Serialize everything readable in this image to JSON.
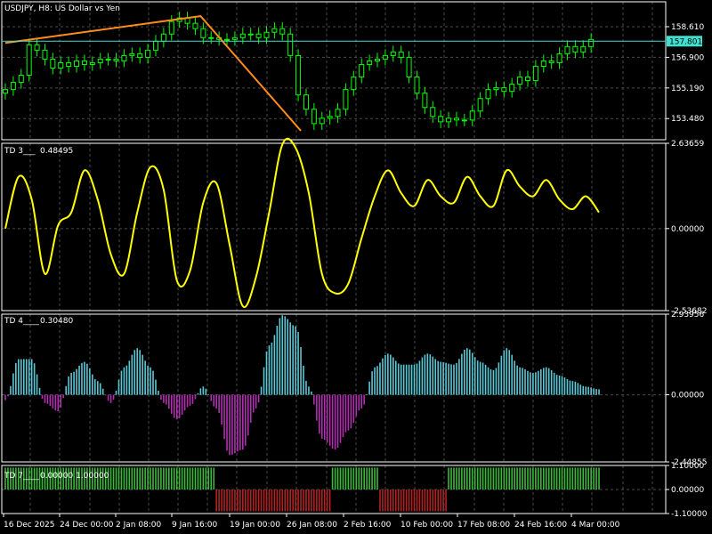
{
  "header": {
    "symbol_title": "USDJPY, H8:  US Dollar vs Yen",
    "td3_name": "TD 3___",
    "td3_value": "0.48495",
    "td4_name": "TD 4____",
    "td4_value": "0.30480",
    "td7_name": "TD 7____",
    "td7_values": "0.00000  1.00000"
  },
  "colors": {
    "background": "#000000",
    "grid": "#4a4a4a",
    "candle": "#00ff00",
    "price_line": "#40e0d0",
    "trend_line": "#ff8c1a",
    "td3_line": "#ffff00",
    "td4_positive": "#5bc8d6",
    "td4_negative": "#b22fb2",
    "td7_positive": "#3cb83c",
    "td7_negative": "#b02222"
  },
  "chart_data": [
    {
      "type": "line",
      "name": "price",
      "title": "USDJPY, H8:  US Dollar vs Yen",
      "ylim": [
        152.3,
        160.0
      ],
      "y_ticks": [
        "158.610",
        "156.900",
        "155.190",
        "153.480"
      ],
      "current_price": "157.801",
      "current_price_value": 157.801,
      "x": [
        0,
        3,
        6,
        9,
        12,
        15,
        18,
        21,
        24,
        27,
        30,
        33,
        36,
        39,
        42,
        45,
        48,
        51,
        54,
        57,
        60,
        63,
        66,
        69,
        72,
        75,
        78,
        81,
        84,
        87,
        90,
        93,
        96,
        99,
        102,
        105,
        108,
        111,
        114,
        117,
        120,
        123,
        126,
        129,
        132,
        135,
        138,
        141,
        144,
        147,
        150,
        153,
        156,
        159,
        162,
        165,
        168,
        171,
        174,
        177,
        180,
        183,
        186,
        189,
        192,
        195,
        198,
        201,
        204,
        207,
        210,
        213,
        216,
        219,
        222
      ],
      "close": [
        155.1,
        155.5,
        155.9,
        157.6,
        157.3,
        156.8,
        156.3,
        156.6,
        156.4,
        156.7,
        156.5,
        156.6,
        156.8,
        156.8,
        156.7,
        157.0,
        157.1,
        156.9,
        157.3,
        157.8,
        158.2,
        158.9,
        159.1,
        158.8,
        158.5,
        158.0,
        158.0,
        157.9,
        157.9,
        158.0,
        158.2,
        158.2,
        158.0,
        158.3,
        158.5,
        158.2,
        157.0,
        154.8,
        154.0,
        153.2,
        153.5,
        153.6,
        154.0,
        155.1,
        155.8,
        156.5,
        156.7,
        156.8,
        157.0,
        157.2,
        156.9,
        155.8,
        154.9,
        154.1,
        153.6,
        153.3,
        153.5,
        153.4,
        153.4,
        153.9,
        154.6,
        155.1,
        155.2,
        155.0,
        155.4,
        155.8,
        155.6,
        156.4,
        156.7,
        156.6,
        157.1,
        157.5,
        157.2,
        157.5,
        157.9
      ],
      "trend_line": [
        {
          "x": 0,
          "y": 157.7
        },
        {
          "x": 74,
          "y": 159.2
        },
        {
          "x": 112,
          "y": 152.8
        }
      ]
    },
    {
      "type": "line",
      "name": "TD 3",
      "ylim": [
        -2.53682,
        2.63659
      ],
      "y_ticks": [
        "2.63659",
        "0.00000",
        "-2.53682"
      ],
      "x": [
        0,
        5,
        10,
        15,
        20,
        25,
        30,
        35,
        40,
        45,
        50,
        55,
        60,
        65,
        70,
        75,
        80,
        85,
        90,
        95,
        100,
        105,
        110,
        115,
        120,
        125,
        130,
        135,
        140,
        145,
        150,
        155,
        160,
        165,
        170,
        175,
        180,
        185,
        190,
        195,
        200,
        205,
        210,
        215,
        220,
        225
      ],
      "y": [
        0.0,
        1.6,
        0.9,
        -1.4,
        0.1,
        0.5,
        1.8,
        0.9,
        -0.8,
        -1.4,
        0.5,
        1.9,
        1.2,
        -1.6,
        -1.3,
        0.8,
        1.4,
        -0.5,
        -2.4,
        -1.5,
        0.5,
        2.6,
        2.5,
        1.1,
        -1.4,
        -2.0,
        -1.7,
        -0.3,
        1.0,
        1.8,
        1.1,
        0.7,
        1.5,
        1.0,
        0.8,
        1.6,
        1.0,
        0.7,
        1.8,
        1.3,
        1.0,
        1.5,
        0.9,
        0.6,
        1.0,
        0.5
      ]
    },
    {
      "type": "bar",
      "name": "TD 4",
      "ylim": [
        -2.44855,
        2.93956
      ],
      "y_ticks": [
        "2.93956",
        "0.00000",
        "-2.44855"
      ],
      "x": [
        0,
        5,
        10,
        15,
        20,
        25,
        30,
        35,
        40,
        45,
        50,
        55,
        60,
        65,
        70,
        75,
        80,
        85,
        90,
        95,
        100,
        105,
        110,
        115,
        120,
        125,
        130,
        135,
        140,
        145,
        150,
        155,
        160,
        165,
        170,
        175,
        180,
        185,
        190,
        195,
        200,
        205,
        210,
        215,
        220,
        225
      ],
      "y": [
        -0.2,
        1.3,
        1.3,
        -0.3,
        -0.6,
        0.8,
        1.2,
        0.5,
        -0.3,
        1.0,
        1.7,
        1.0,
        -0.3,
        -0.9,
        -0.4,
        0.3,
        -0.5,
        -2.2,
        -2.0,
        -0.5,
        1.8,
        2.9,
        2.5,
        0.3,
        -1.6,
        -2.0,
        -1.3,
        -0.5,
        1.0,
        1.5,
        1.1,
        1.1,
        1.5,
        1.2,
        1.1,
        1.7,
        1.2,
        0.9,
        1.7,
        1.0,
        0.8,
        1.0,
        0.7,
        0.5,
        0.3,
        0.2
      ]
    },
    {
      "type": "bar",
      "name": "TD 7",
      "ylim": [
        -1.1,
        1.1
      ],
      "y_ticks": [
        "1.10000",
        "0.00000",
        "-1.10000"
      ],
      "segments": [
        {
          "from": 0,
          "to": 79,
          "value": 1
        },
        {
          "from": 80,
          "to": 123,
          "value": -1
        },
        {
          "from": 124,
          "to": 141,
          "value": 1
        },
        {
          "from": 142,
          "to": 167,
          "value": -1
        },
        {
          "from": 168,
          "to": 225,
          "value": 1
        }
      ]
    }
  ],
  "x_axis": {
    "labels": [
      "16 Dec 2025",
      "24 Dec 00:00",
      "2 Jan 08:00",
      "9 Jan 16:00",
      "19 Jan 00:00",
      "26 Jan 08:00",
      "2 Feb 16:00",
      "10 Feb 00:00",
      "17 Feb 08:00",
      "24 Feb 16:00",
      "4 Mar 00:00"
    ]
  }
}
